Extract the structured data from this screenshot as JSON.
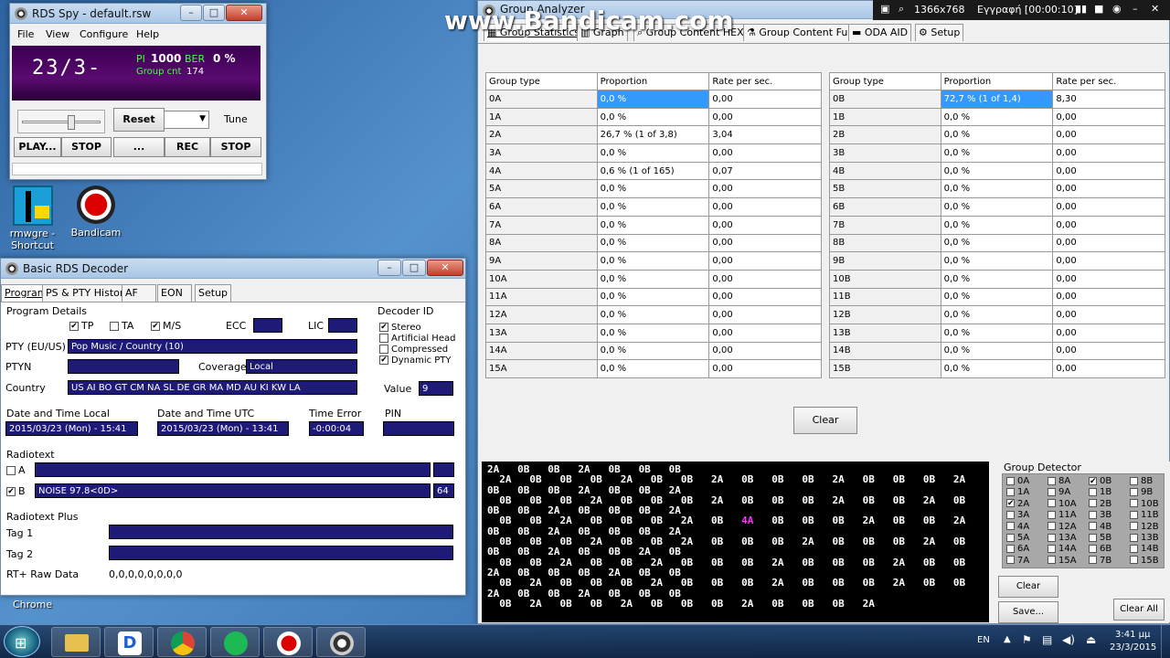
{
  "desktop": {
    "icons": [
      {
        "label": "rmwgre - Shortcut"
      },
      {
        "label": "Bandicam"
      }
    ],
    "chrome_label": "Chrome"
  },
  "watermark": "www.Bandicam.com",
  "rec_bar": {
    "resolution": "1366x768",
    "record": "Εγγραφή [00:00:10]"
  },
  "rds_spy": {
    "title": "RDS Spy - default.rsw",
    "menu": [
      "File",
      "View",
      "Configure",
      "Help"
    ],
    "ps": "23/3-",
    "pi_label": "PI",
    "pi": "1000",
    "ber_label": "BER",
    "ber": "0 %",
    "group_cnt_label": "Group cnt",
    "group_cnt": "174",
    "reset": "Reset",
    "tune": "Tune",
    "play": "PLAY...",
    "stop1": "STOP",
    "dots": "...",
    "rec": "REC",
    "stop2": "STOP"
  },
  "decoder": {
    "title": "Basic RDS Decoder",
    "tabs": [
      "Program",
      "PS & PTY History",
      "AF",
      "EON",
      "Setup"
    ],
    "program_details": "Program Details",
    "tp": "TP",
    "ta": "TA",
    "ms": "M/S",
    "ecc": "ECC",
    "lic": "LIC",
    "pty_label": "PTY (EU/US)",
    "pty": "Pop Music / Country (10)",
    "ptyn_label": "PTYN",
    "coverage_label": "Coverage",
    "coverage": "Local",
    "country_label": "Country",
    "country": "US AI BO GT CM NA SL DE GR MA MD AU KI KW LA",
    "decoder_id": "Decoder ID",
    "stereo": "Stereo",
    "artificial_head": "Artificial Head",
    "compressed": "Compressed",
    "dynamic_pty": "Dynamic PTY",
    "value_label": "Value",
    "value": "9",
    "dt_local_label": "Date and Time Local",
    "dt_local": "2015/03/23 (Mon) - 15:41",
    "dt_utc_label": "Date and Time UTC",
    "dt_utc": "2015/03/23 (Mon) - 13:41",
    "time_error_label": "Time Error",
    "time_error": "-0:00:04",
    "pin_label": "PIN",
    "radiotext": "Radiotext",
    "rt_a": "A",
    "rt_b": "B",
    "rt_b_text": "NOISE 97.8<0D>",
    "rt_b_len": "64",
    "rtplus": "Radiotext Plus",
    "tag1": "Tag 1",
    "tag2": "Tag 2",
    "raw_label": "RT+ Raw Data",
    "raw": "0,0,0,0,0,0,0,0"
  },
  "analyzer": {
    "title": "Group Analyzer",
    "tabs": [
      "Group Statistics",
      "Graph",
      "Group Content HEX",
      "Group Content Full",
      "ODA AID",
      "Setup"
    ],
    "headers": [
      "Group type",
      "Proportion",
      "Rate per sec."
    ],
    "left": [
      [
        "0A",
        "0,0 %",
        "0,00"
      ],
      [
        "1A",
        "0,0 %",
        "0,00"
      ],
      [
        "2A",
        "26,7 %  (1 of 3,8)",
        "3,04"
      ],
      [
        "3A",
        "0,0 %",
        "0,00"
      ],
      [
        "4A",
        "0,6 %  (1 of 165)",
        "0,07"
      ],
      [
        "5A",
        "0,0 %",
        "0,00"
      ],
      [
        "6A",
        "0,0 %",
        "0,00"
      ],
      [
        "7A",
        "0,0 %",
        "0,00"
      ],
      [
        "8A",
        "0,0 %",
        "0,00"
      ],
      [
        "9A",
        "0,0 %",
        "0,00"
      ],
      [
        "10A",
        "0,0 %",
        "0,00"
      ],
      [
        "11A",
        "0,0 %",
        "0,00"
      ],
      [
        "12A",
        "0,0 %",
        "0,00"
      ],
      [
        "13A",
        "0,0 %",
        "0,00"
      ],
      [
        "14A",
        "0,0 %",
        "0,00"
      ],
      [
        "15A",
        "0,0 %",
        "0,00"
      ]
    ],
    "right": [
      [
        "0B",
        "72,7 %  (1 of 1,4)",
        "8,30"
      ],
      [
        "1B",
        "0,0 %",
        "0,00"
      ],
      [
        "2B",
        "0,0 %",
        "0,00"
      ],
      [
        "3B",
        "0,0 %",
        "0,00"
      ],
      [
        "4B",
        "0,0 %",
        "0,00"
      ],
      [
        "5B",
        "0,0 %",
        "0,00"
      ],
      [
        "6B",
        "0,0 %",
        "0,00"
      ],
      [
        "7B",
        "0,0 %",
        "0,00"
      ],
      [
        "8B",
        "0,0 %",
        "0,00"
      ],
      [
        "9B",
        "0,0 %",
        "0,00"
      ],
      [
        "10B",
        "0,0 %",
        "0,00"
      ],
      [
        "11B",
        "0,0 %",
        "0,00"
      ],
      [
        "12B",
        "0,0 %",
        "0,00"
      ],
      [
        "13B",
        "0,0 %",
        "0,00"
      ],
      [
        "14B",
        "0,0 %",
        "0,00"
      ],
      [
        "15B",
        "0,0 %",
        "0,00"
      ]
    ],
    "clear": "Clear",
    "stream": "2A   0B   0B   2A   0B   0B   0B\n  2A   0B   0B   0B   2A   0B   0B   2A   0B   0B   0B   2A   0B   0B   0B   2A\n0B   0B   0B   2A   0B   0B   2A\n  0B   0B   0B   2A   0B   0B   0B   2A   0B   0B   0B   2A   0B   0B   2A   0B\n0B   0B   2A   0B   0B   0B   2A\n  0B   0B   2A   0B   0B   0B   2A   0B   4A   0B   0B   0B   2A   0B   0B   2A\n0B   0B   2A   0B   0B   0B   2A\n  0B   0B   0B   2A   0B   0B   2A   0B   0B   0B   2A   0B   0B   0B   2A   0B\n0B   0B   2A   0B   0B   2A   0B\n  0B   0B   2A   0B   0B   2A   0B   0B   0B   2A   0B   0B   0B   2A   0B   0B\n2A   0B   0B   0B   2A   0B   0B\n  0B   2A   0B   0B   0B   2A   0B   0B   0B   2A   0B   0B   0B   2A   0B   0B\n2A   0B   0B   2A   0B   0B   0B\n  0B   2A   0B   0B   2A   0B   0B   0B   2A   0B   0B   0B   2A",
    "group_detector": "Group Detector",
    "gd": [
      [
        "0A",
        "8A",
        "0B",
        "8B"
      ],
      [
        "1A",
        "9A",
        "1B",
        "9B"
      ],
      [
        "2A",
        "10A",
        "2B",
        "10B"
      ],
      [
        "3A",
        "11A",
        "3B",
        "11B"
      ],
      [
        "4A",
        "12A",
        "4B",
        "12B"
      ],
      [
        "5A",
        "13A",
        "5B",
        "13B"
      ],
      [
        "6A",
        "14A",
        "6B",
        "14B"
      ],
      [
        "7A",
        "15A",
        "7B",
        "15B"
      ]
    ],
    "gd_clear": "Clear",
    "save": "Save...",
    "clear_all": "Clear All"
  },
  "tray": {
    "lang": "EN",
    "time": "3:41 μμ",
    "date": "23/3/2015"
  }
}
